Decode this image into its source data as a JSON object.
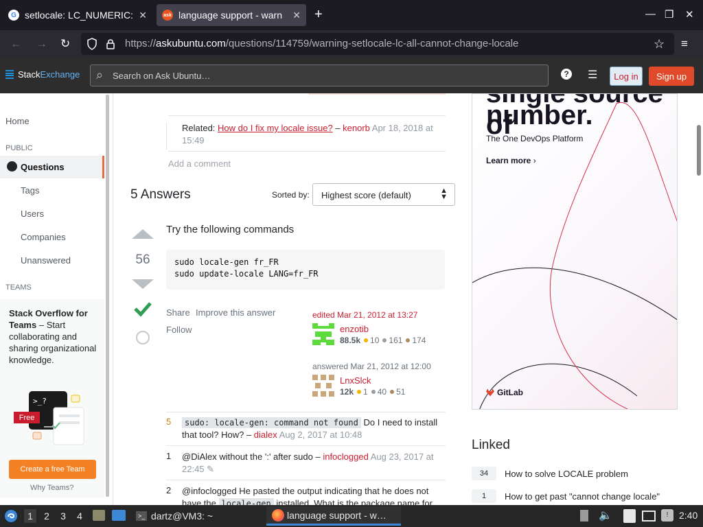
{
  "browser": {
    "tabs": [
      {
        "label": "setlocale: LC_NUMERIC: c",
        "favicon": "google-g"
      },
      {
        "label": "language support - warn",
        "favicon": "askubuntu"
      }
    ],
    "url_prefix": "https://",
    "url_host": "askubuntu.com",
    "url_path": "/questions/114759/warning-setlocale-lc-all-cannot-change-locale"
  },
  "header": {
    "logo_part1": "Stack",
    "logo_part2": "Exchange",
    "search_placeholder": "Search on Ask Ubuntu…",
    "login_label": "Log in",
    "signup_label": "Sign up"
  },
  "sidebar": {
    "home": "Home",
    "public_heading": "PUBLIC",
    "questions": "Questions",
    "tags": "Tags",
    "users": "Users",
    "companies": "Companies",
    "unanswered": "Unanswered",
    "teams_heading": "TEAMS",
    "teams_bold": "Stack Overflow for Teams",
    "teams_rest": " – Start collaborating and sharing organizational knowledge.",
    "free_badge": "Free",
    "create_team": "Create a free Team",
    "why_teams": "Why Teams?"
  },
  "question": {
    "related_prefix": "Related: ",
    "related_link": "How do I fix my locale issue?",
    "related_dash": " – ",
    "related_user": "kenorb",
    "related_date": " Apr 18, 2018 at 15:49",
    "add_comment": "Add a comment"
  },
  "answers": {
    "title": "5 Answers",
    "sorted_by": "Sorted by:",
    "sort_value": "Highest score (default)"
  },
  "answer": {
    "score": "56",
    "text": "Try the following commands",
    "code_lines": [
      "sudo locale-gen fr_FR",
      "sudo update-locale LANG=fr_FR"
    ],
    "share": "Share",
    "improve": "Improve this answer",
    "follow": "Follow",
    "edited_label": "edited Mar 21, 2012 at 13:27",
    "editor_name": "enzotib",
    "editor_rep": "88.5k",
    "editor_gold": "10",
    "editor_silver": "161",
    "editor_bronze": "174",
    "answered_label": "answered Mar 21, 2012 at 12:00",
    "author_name": "LnxSlck",
    "author_rep": "12k",
    "author_gold": "1",
    "author_silver": "40",
    "author_bronze": "51"
  },
  "comments": [
    {
      "score": "5",
      "code": "sudo: locale-gen: command not found",
      "text": " Do I need to install that tool? How? – ",
      "user": "dialex",
      "date": " Aug 2, 2017 at 10:48"
    },
    {
      "score": "1",
      "text": "@DiAlex without the ':' after sudo – ",
      "user": "infoclogged",
      "date": " Aug 23, 2017 at 22:45"
    },
    {
      "score": "2",
      "text": "@infoclogged He pasted the output indicating that he does not have the ",
      "code": "locale-gen",
      "text2": " installed. What is the package name for"
    }
  ],
  "ad": {
    "headline_top": "single source of",
    "headline": "number.",
    "subline": "The One DevOps Platform",
    "cta": "Learn more",
    "brand": "GitLab"
  },
  "linked": {
    "heading": "Linked",
    "items": [
      {
        "count": "34",
        "title": "How to solve LOCALE problem"
      },
      {
        "count": "1",
        "title": "How to get past \"cannot change locale\""
      }
    ]
  },
  "taskbar": {
    "workspaces": [
      "1",
      "2",
      "3",
      "4"
    ],
    "terminal_task": "dartz@VM3: ~",
    "browser_task": "language support - w…",
    "clock": "2:40"
  }
}
